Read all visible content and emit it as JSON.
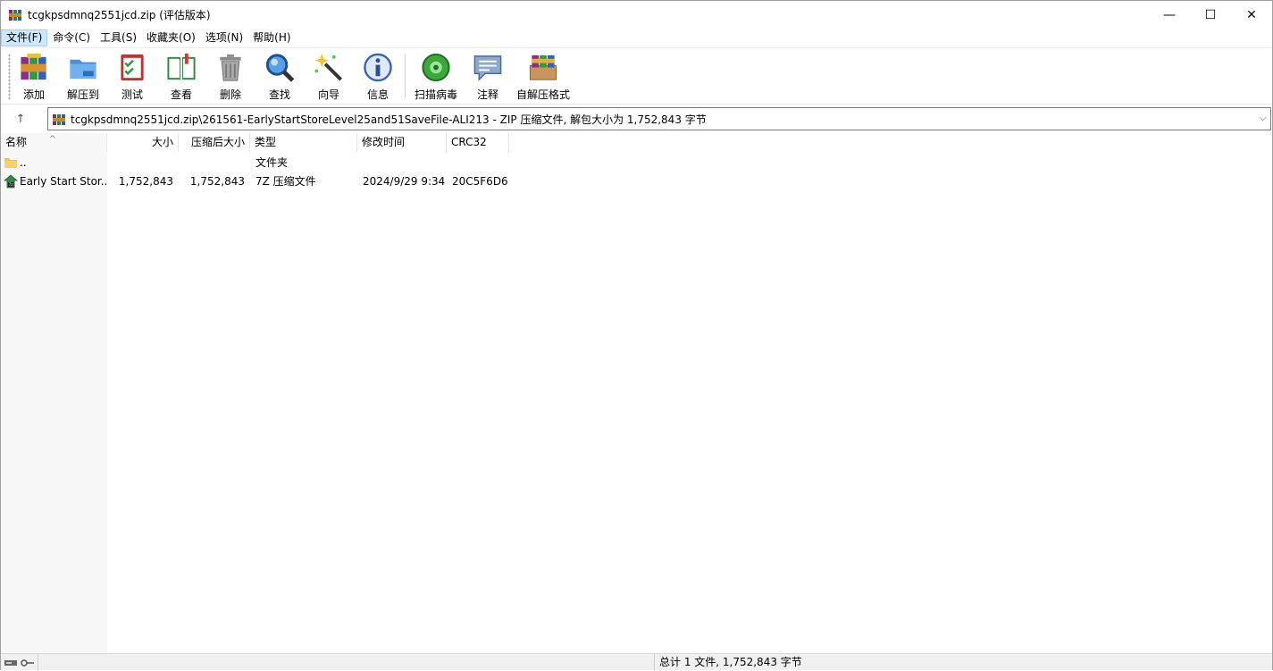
{
  "window": {
    "title": "tcgkpsdmnq2551jcd.zip (评估版本)",
    "minimize": "—",
    "maximize": "☐",
    "close": "✕"
  },
  "menu": [
    "文件(F)",
    "命令(C)",
    "工具(S)",
    "收藏夹(O)",
    "选项(N)",
    "帮助(H)"
  ],
  "toolbar": {
    "add": "添加",
    "extract": "解压到",
    "test": "测试",
    "view": "查看",
    "delete": "删除",
    "find": "查找",
    "wizard": "向导",
    "info": "信息",
    "scan": "扫描病毒",
    "comment": "注释",
    "sfx": "自解压格式"
  },
  "address": {
    "path": "tcgkpsdmnq2551jcd.zip\\261561-EarlyStartStoreLevel25and51SaveFile-ALI213 - ZIP 压缩文件, 解包大小为 1,752,843 字节"
  },
  "columns": {
    "name": "名称",
    "size": "大小",
    "packed": "压缩后大小",
    "type": "类型",
    "modified": "修改时间",
    "crc": "CRC32"
  },
  "rows": [
    {
      "name": "..",
      "size": "",
      "packed": "",
      "type": "文件夹",
      "modified": "",
      "crc": ""
    },
    {
      "name": "Early Start Stor...",
      "size": "1,752,843",
      "packed": "1,752,843",
      "type": "7Z 压缩文件",
      "modified": "2024/9/29 9:34",
      "crc": "20C5F6D6"
    }
  ],
  "status": {
    "total": "总计 1 文件, 1,752,843 字节"
  },
  "icons": {
    "app": "winrar-icon",
    "folder": "folder-icon",
    "archive": "7z-archive-icon"
  }
}
